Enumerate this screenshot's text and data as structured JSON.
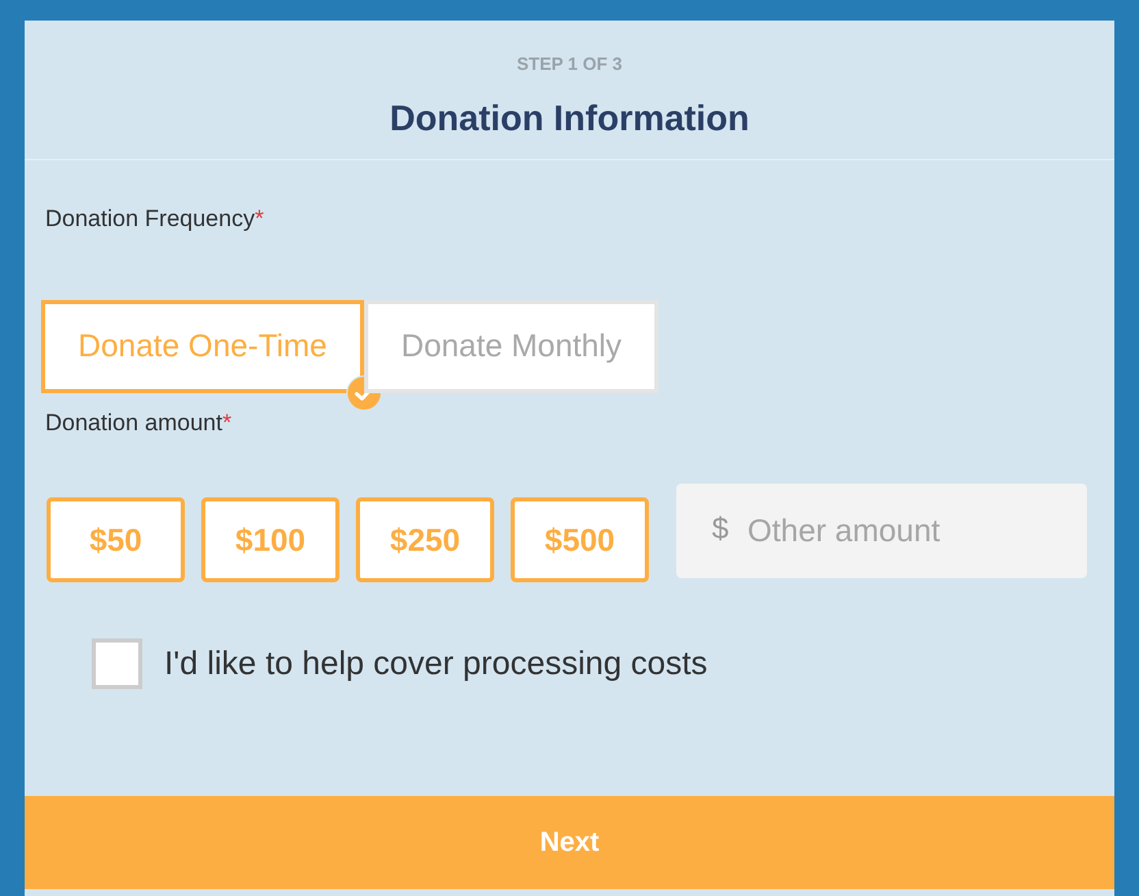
{
  "header": {
    "step": "STEP 1 OF 3",
    "title": "Donation Information"
  },
  "frequency": {
    "label": "Donation Frequency",
    "required_mark": "*",
    "options": [
      {
        "label": "Donate One-Time",
        "selected": true
      },
      {
        "label": "Donate Monthly",
        "selected": false
      }
    ]
  },
  "amount": {
    "label": "Donation amount",
    "required_mark": "*",
    "options": [
      {
        "label": "$50",
        "selected": false
      },
      {
        "label": "$100",
        "selected": false
      },
      {
        "label": "$250",
        "selected": false
      },
      {
        "label": "$500",
        "selected": false
      }
    ],
    "other": {
      "prefix": "$",
      "placeholder": "Other amount"
    }
  },
  "cover_costs": {
    "label": "I'd like to help cover processing costs",
    "checked": false
  },
  "next_button": "Next"
}
